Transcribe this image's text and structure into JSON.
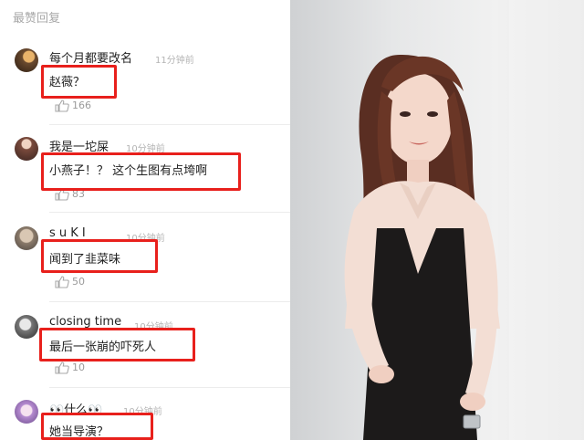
{
  "section_title": "最赞回复",
  "comments": [
    {
      "user": "每个月都要改名",
      "time": "11分钟前",
      "text": "赵薇？",
      "likes": "166"
    },
    {
      "user": "我是一坨屎",
      "time": "10分钟前",
      "text": "小燕子！？ 这个生图有点垮啊",
      "likes": "83"
    },
    {
      "user": "s u K   I",
      "time": "10分钟前",
      "text": "闻到了韭菜味",
      "likes": "50"
    },
    {
      "user": "closing time",
      "time": "10分钟前",
      "text": "最后一张崩的吓死人",
      "likes": "10"
    },
    {
      "user": "👀什么👀",
      "time": "10分钟前",
      "text": "她当导演？",
      "likes": ""
    }
  ],
  "colors": {
    "highlight": "#e8201c",
    "muted": "#b4b4b4"
  }
}
